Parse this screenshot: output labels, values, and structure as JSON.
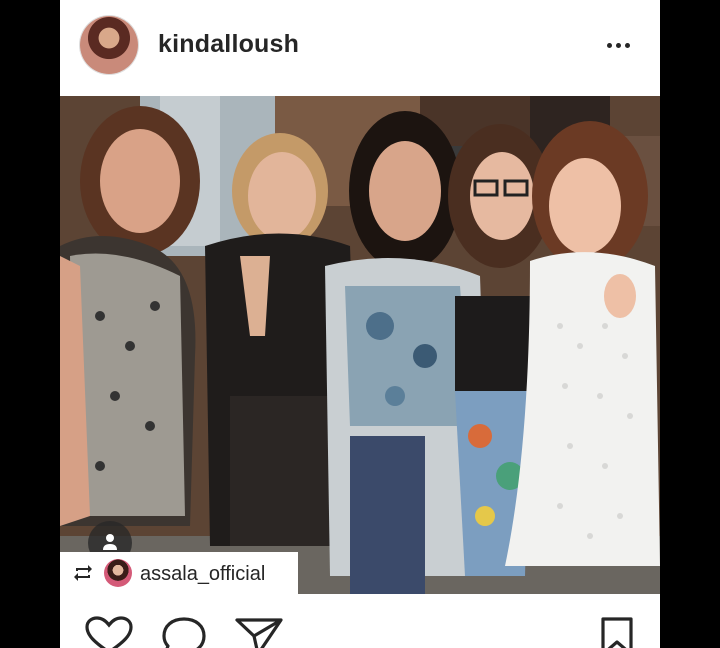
{
  "post": {
    "author": {
      "username": "kindalloush",
      "avatar_icon": "profile-avatar"
    },
    "more_icon": "more-horizontal-icon",
    "photo": {
      "description_icon": "group-photo"
    },
    "repost": {
      "icon": "repost-icon",
      "username": "assala_official"
    },
    "actions": {
      "like_icon": "heart-icon",
      "comment_icon": "comment-icon",
      "share_icon": "send-icon",
      "save_icon": "bookmark-icon"
    }
  },
  "colors": {
    "text": "#262626",
    "frame": "#000000",
    "card": "#ffffff"
  }
}
